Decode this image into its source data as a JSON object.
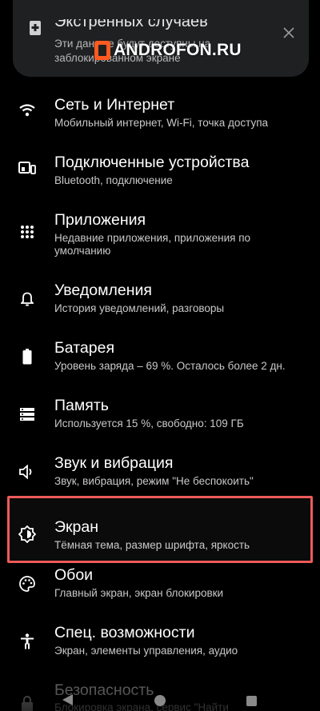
{
  "card": {
    "title": "Экстренных случаев",
    "subtitle": "Эти данные будут доступны на заблокированном экране",
    "close_icon": "close-icon"
  },
  "watermark": {
    "text": "ANDROFON.RU"
  },
  "settings": [
    {
      "icon": "wifi-icon",
      "title": "Сеть и Интернет",
      "subtitle": "Мобильный интернет, Wi-Fi, точка доступа"
    },
    {
      "icon": "devices-icon",
      "title": "Подключенные устройства",
      "subtitle": "Bluetooth, подключение"
    },
    {
      "icon": "apps-grid-icon",
      "title": "Приложения",
      "subtitle": "Недавние приложения, приложения по умолчанию"
    },
    {
      "icon": "bell-icon",
      "title": "Уведомления",
      "subtitle": "История уведомлений, разговоры"
    },
    {
      "icon": "battery-icon",
      "title": "Батарея",
      "subtitle": "Уровень заряда – 69 %. Осталось более 2 дн."
    },
    {
      "icon": "storage-icon",
      "title": "Память",
      "subtitle": "Используется 15 %, свободно: 109 ГБ"
    },
    {
      "icon": "volume-icon",
      "title": "Звук и вибрация",
      "subtitle": "Звук, вибрация, режим \"Не беспокоить\""
    },
    {
      "icon": "brightness-icon",
      "title": "Экран",
      "subtitle": "Тёмная тема, размер шрифта, яркость"
    },
    {
      "icon": "palette-icon",
      "title": "Обои",
      "subtitle": "Главный экран, экран блокировки"
    },
    {
      "icon": "accessibility-icon",
      "title": "Спец. возможности",
      "subtitle": "Экран, элементы управления, аудио"
    },
    {
      "icon": "lock-icon",
      "title": "Безопасность",
      "subtitle": "Блокировка экрана, сервис \"Найти"
    }
  ],
  "colors": {
    "background": "#000000",
    "highlight": "#ee5a5a",
    "card": "#1f2022",
    "watermark_logo": "#ff5a1f"
  },
  "navbar": {
    "back": "back-icon",
    "home": "home-icon",
    "recents": "recents-icon"
  }
}
